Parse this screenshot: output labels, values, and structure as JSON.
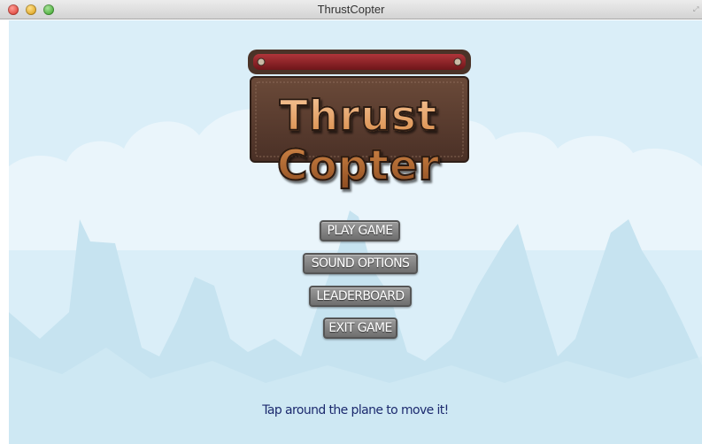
{
  "window": {
    "title": "ThrustCopter"
  },
  "game": {
    "logo_text": "Thrust Copter",
    "menu": [
      {
        "label": "PLAY GAME"
      },
      {
        "label": "SOUND OPTIONS"
      },
      {
        "label": "LEADERBOARD"
      },
      {
        "label": "EXIT GAME"
      }
    ],
    "hint": "Tap around the plane to move it!"
  },
  "colors": {
    "sky": "#daeef8",
    "clouds": "#eaf5fb",
    "mountains": "#c6e3f0",
    "button_fill": "#8a8a8a",
    "hint_text": "#1c2a6e",
    "logo_panel": "#5a3c2e",
    "logo_bar": "#8a1f24"
  },
  "icons": {
    "close": "close-icon",
    "minimize": "minimize-icon",
    "maximize": "maximize-icon",
    "fullscreen": "fullscreen-icon"
  }
}
